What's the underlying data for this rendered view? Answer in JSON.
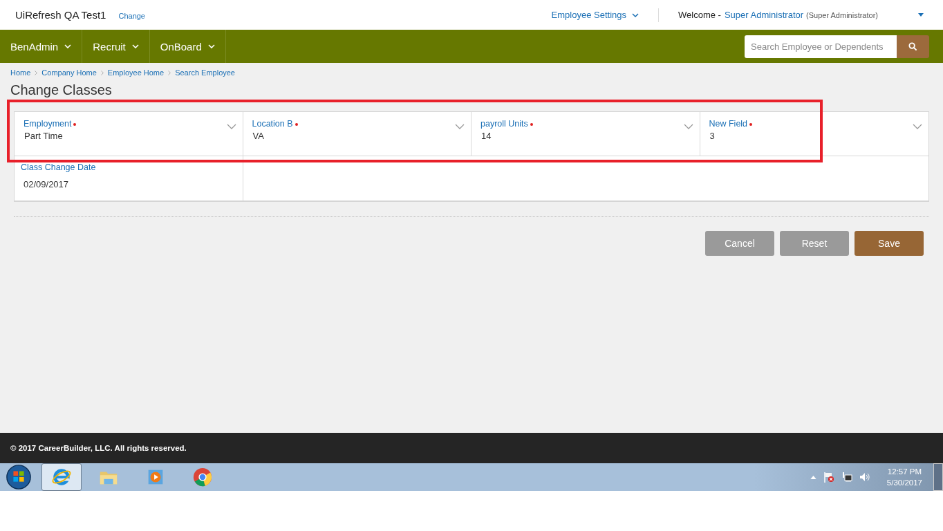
{
  "header": {
    "app_title": "UiRefresh QA Test1",
    "change_link": "Change",
    "settings_menu": "Employee Settings",
    "welcome_label": "Welcome -",
    "user_name": "Super Administrator",
    "user_role": "(Super Administrator)"
  },
  "nav": {
    "items": [
      {
        "label": "BenAdmin"
      },
      {
        "label": "Recruit"
      },
      {
        "label": "OnBoard"
      }
    ],
    "search": {
      "placeholder": "Search Employee or Dependents"
    }
  },
  "breadcrumbs": [
    "Home",
    "Company Home",
    "Employee Home",
    "Search Employee"
  ],
  "page_title": "Change Classes",
  "highlight": true,
  "fields": [
    {
      "kind": "select",
      "label": "Employment",
      "required": true,
      "value": "Part Time"
    },
    {
      "kind": "select",
      "label": "Location B",
      "required": true,
      "value": "VA"
    },
    {
      "kind": "select",
      "label": "payroll Units",
      "required": true,
      "value": "14"
    },
    {
      "kind": "select",
      "label": "New Field",
      "required": true,
      "value": "3"
    },
    {
      "kind": "date",
      "label": "Class Change Date",
      "required": false,
      "value": "02/09/2017"
    }
  ],
  "buttons": [
    {
      "kind": "secondary",
      "label": "Cancel"
    },
    {
      "kind": "secondary",
      "label": "Reset"
    },
    {
      "kind": "primary",
      "label": "Save"
    }
  ],
  "footer": "© 2017 CareerBuilder, LLC. All rights reserved.",
  "taskbar": {
    "apps": [
      {
        "kind": "browser-e",
        "selected": true
      },
      {
        "kind": "folder",
        "selected": false
      },
      {
        "kind": "player",
        "selected": false
      },
      {
        "kind": "chrome",
        "selected": false
      }
    ],
    "time": "12:57 PM",
    "date": "5/30/2017"
  }
}
